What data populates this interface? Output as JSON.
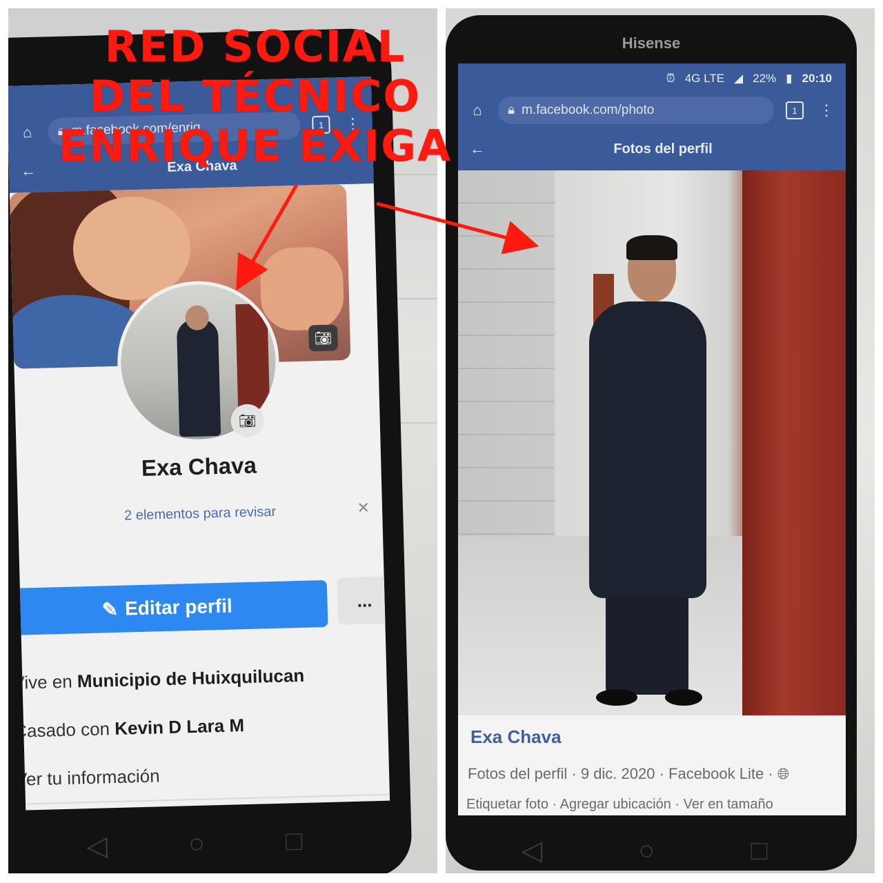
{
  "annotation": {
    "headline_lines": [
      "RED SOCIAL",
      "DEL TÉCNICO",
      "ENRIQUE EXIGA"
    ],
    "color": "#ff1a0f"
  },
  "left_screen": {
    "browser": {
      "home_icon": "home-icon",
      "url": "m.facebook.com/enriq",
      "tab_count": "1",
      "back_icon": "back-arrow-icon",
      "page_title": "Exa Chava"
    },
    "profile": {
      "name": "Exa Chava",
      "review_link": "2 elementos para revisar",
      "close_icon": "close-icon",
      "edit_button": "Editar perfil",
      "edit_icon": "pencil-icon",
      "more_button": "...",
      "lives_prefix": "Vive en",
      "lives_value": "Municipio de Huixquilucan",
      "married_prefix": "Casado con",
      "married_value": "Kevin D Lara M",
      "see_info": "Ver tu información"
    },
    "nav": {
      "back": "◁",
      "home": "○",
      "recents": "□"
    }
  },
  "right_screen": {
    "device_brand": "Hisense",
    "status": {
      "network": "4G LTE",
      "battery": "22%",
      "time": "20:10"
    },
    "browser": {
      "home_icon": "home-icon",
      "url": "m.facebook.com/photo",
      "tab_count": "1",
      "back_icon": "back-arrow-icon",
      "page_title": "Fotos del perfil"
    },
    "post": {
      "author": "Exa Chava",
      "meta": "Fotos del perfil · 9 dic. 2020 · Facebook Lite ·",
      "globe_icon": "globe-icon",
      "actions": "Etiquetar foto · Agregar ubicación · Ver en tamaño"
    },
    "nav": {
      "back": "◁",
      "home": "○",
      "recents": "□"
    }
  },
  "colors": {
    "facebook_blue": "#3b5a9a",
    "edit_button_blue": "#2d88ef",
    "link_blue": "#4a6bb3"
  }
}
